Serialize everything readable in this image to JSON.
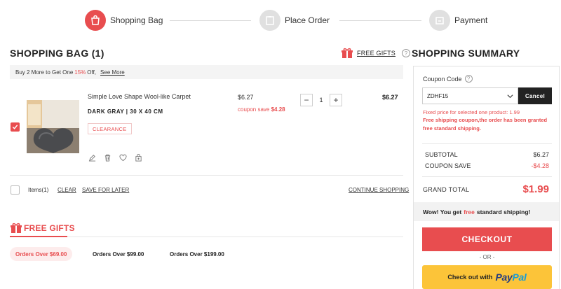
{
  "steps": [
    {
      "label": "Shopping Bag",
      "icon": "shopping-bag-icon",
      "active": true
    },
    {
      "label": "Place Order",
      "icon": "clipboard-icon",
      "active": false
    },
    {
      "label": "Payment",
      "icon": "wallet-icon",
      "active": false
    }
  ],
  "bag": {
    "title": "SHOPPING BAG (1)",
    "free_gifts_link": "FREE GIFTS",
    "help": "?",
    "promo": {
      "before": "Buy 2 More to Get One",
      "pct": "15%",
      "after": "Off,",
      "see_more": "See More"
    }
  },
  "item": {
    "name": "Simple Love Shape Wool-like Carpet",
    "variant": "DARK GRAY | 30 X 40 CM",
    "badge": "CLEARANCE",
    "price": "$6.27",
    "coupon_save_label": "coupon save",
    "coupon_save_amount": "$4.28",
    "qty_minus": "−",
    "quantity": "1",
    "qty_plus": "+",
    "total": "$6.27",
    "checked": true
  },
  "footer": {
    "items_count": "Items(1)",
    "clear": "CLEAR",
    "save_for_later": "SAVE FOR LATER",
    "continue": "CONTINUE SHOPPING"
  },
  "free_gifts": {
    "title": "FREE GIFTS",
    "tiers": [
      {
        "label": "Orders Over $69.00",
        "active": true
      },
      {
        "label": "Orders Over $99.00",
        "active": false
      },
      {
        "label": "Orders Over $199.00",
        "active": false
      }
    ]
  },
  "summary": {
    "title": "SHOPPING SUMMARY",
    "coupon_label": "Coupon Code",
    "help": "?",
    "coupon_value": "ZDHF15",
    "cancel": "Cancel",
    "coupon_msg1": "Fixed price for selected one product: 1.99",
    "coupon_msg2": "Free shipping coupon,the order has been granted free standard shipping.",
    "subtotal_label": "SUBTOTAL",
    "subtotal_value": "$6.27",
    "coupon_save_label": "COUPON SAVE",
    "coupon_save_value": "-$4.28",
    "grand_total_label": "GRAND TOTAL",
    "grand_total_value": "$1.99",
    "ship_before": "Wow! You get",
    "ship_free": "free",
    "ship_after": "standard shipping!",
    "checkout": "CHECKOUT",
    "or": "- OR -",
    "paypal_prefix": "Check out with",
    "paypal_logo_1": "Pay",
    "paypal_logo_2": "Pal"
  },
  "colors": {
    "accent": "#e84d4f",
    "muted": "#e0e0e0",
    "paypal_yellow": "#fcc439"
  }
}
